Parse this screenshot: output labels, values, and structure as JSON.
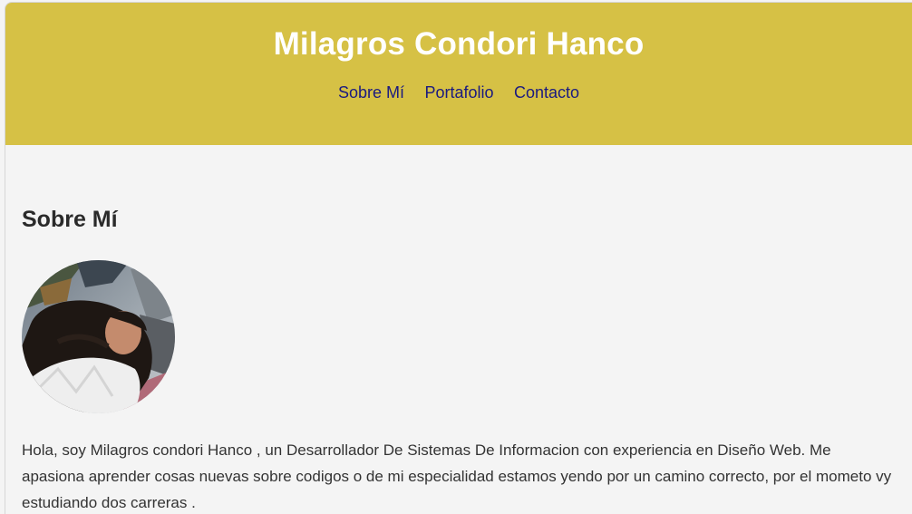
{
  "header": {
    "title": "Milagros Condori Hanco",
    "bg_color": "#d6c145",
    "nav": [
      {
        "label": "Sobre Mí"
      },
      {
        "label": "Portafolio"
      },
      {
        "label": "Contacto"
      }
    ]
  },
  "about": {
    "heading": "Sobre Mí",
    "photo": "profile-photo",
    "text": "Hola, soy Milagros condori Hanco , un Desarrollador De Sistemas De Informacion con experiencia en Diseño Web. Me apasiona aprender cosas nuevas sobre codigos o de mi especialidad estamos yendo por un camino correcto, por el mometo vy estudiando dos carreras ."
  }
}
